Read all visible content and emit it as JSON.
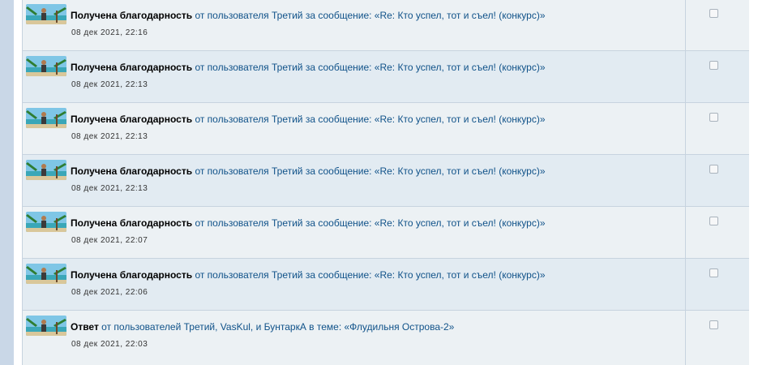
{
  "notifications": [
    {
      "title": "Получена благодарность",
      "text": "от пользователя Третий за сообщение: «Re: Кто успел, тот и съел!  (конкурс)»",
      "date": "08 дек 2021, 22:16"
    },
    {
      "title": "Получена благодарность",
      "text": "от пользователя Третий за сообщение: «Re: Кто успел, тот и съел!  (конкурс)»",
      "date": "08 дек 2021, 22:13"
    },
    {
      "title": "Получена благодарность",
      "text": "от пользователя Третий за сообщение: «Re: Кто успел, тот и съел!  (конкурс)»",
      "date": "08 дек 2021, 22:13"
    },
    {
      "title": "Получена благодарность",
      "text": "от пользователя Третий за сообщение: «Re: Кто успел, тот и съел!  (конкурс)»",
      "date": "08 дек 2021, 22:13"
    },
    {
      "title": "Получена благодарность",
      "text": "от пользователя Третий за сообщение: «Re: Кто успел, тот и съел!  (конкурс)»",
      "date": "08 дек 2021, 22:07"
    },
    {
      "title": "Получена благодарность",
      "text": "от пользователя Третий за сообщение: «Re: Кто успел, тот и съел!  (конкурс)»",
      "date": "08 дек 2021, 22:06"
    },
    {
      "title": "Ответ",
      "text": "от пользователей Третий, VasKul, и БунтаркА в теме: «Флудильня Острова-2»",
      "date": "08 дек 2021, 22:03"
    }
  ],
  "colors": {
    "link": "#105289",
    "row_odd": "#ecf1f4",
    "row_even": "#e2ebf2",
    "border": "#c7d3df"
  }
}
